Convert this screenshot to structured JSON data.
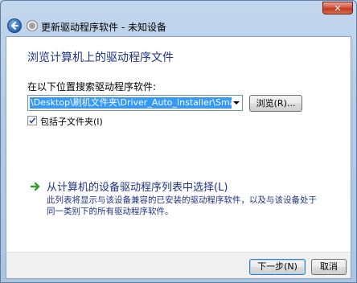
{
  "window": {
    "close_label": "✕",
    "header_title": "更新驱动程序软件 - 未知设备"
  },
  "page": {
    "title": "浏览计算机上的驱动程序文件",
    "search_label": "在以下位置搜索驱动程序软件:",
    "path_value": "\\Desktop\\刷机文件夹\\Driver_Auto_Installer\\SmartPhoneDriver",
    "browse_label": "浏览(R)...",
    "include_subfolders_label": "包括子文件夹(I)",
    "include_subfolders_checked": true
  },
  "pick_option": {
    "title": "从计算机的设备驱动程序列表中选择(L)",
    "description": "此列表将显示与该设备兼容的已安装的驱动程序软件，以及与该设备处于同一类别下的所有驱动程序软件。"
  },
  "footer": {
    "next_label": "下一步(N)",
    "cancel_label": "取消"
  },
  "icons": {
    "back": "back-arrow-icon",
    "device": "device-icon",
    "arrow": "green-arrow-icon"
  },
  "colors": {
    "title_blue": "#1e3287",
    "selection": "#3399ff",
    "frame": "#b9d1ea",
    "close_red": "#c23a20"
  }
}
